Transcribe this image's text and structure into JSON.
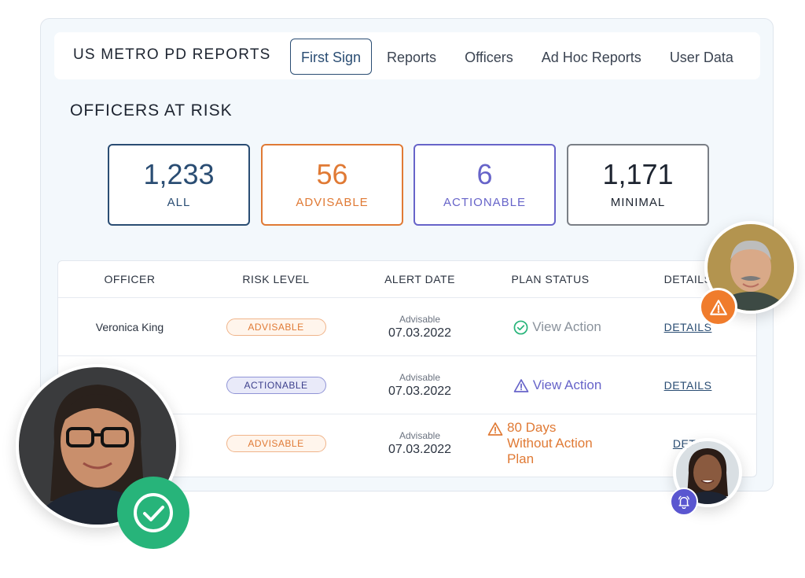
{
  "header": {
    "app_title": "US METRO PD REPORTS",
    "nav": [
      "First Sign",
      "Reports",
      "Officers",
      "Ad Hoc Reports",
      "User Data"
    ]
  },
  "section_title": "OFFICERS AT RISK",
  "stats": [
    {
      "value": "1,233",
      "label": "ALL",
      "color": "#2a4d73"
    },
    {
      "value": "56",
      "label": "ADVISABLE",
      "color": "#e07a35"
    },
    {
      "value": "6",
      "label": "ACTIONABLE",
      "color": "#6764c9"
    },
    {
      "value": "1,171",
      "label": "MINIMAL",
      "color": "#1d2430"
    }
  ],
  "table": {
    "headers": [
      "OFFICER",
      "RISK LEVEL",
      "ALERT DATE",
      "PLAN STATUS",
      "DETAILS"
    ],
    "rows": [
      {
        "officer": "Veronica King",
        "risk": "ADVISABLE",
        "alert_type": "Advisable",
        "alert_date": "07.03.2022",
        "plan": "View Action",
        "plan_icon": "check-circle-icon",
        "details": "DETAILS"
      },
      {
        "officer": "",
        "risk": "ACTIONABLE",
        "alert_type": "Advisable",
        "alert_date": "07.03.2022",
        "plan": "View Action",
        "plan_icon": "warning-triangle-icon",
        "details": "DETAILS"
      },
      {
        "officer": "",
        "risk": "ADVISABLE",
        "alert_type": "Advisable",
        "alert_date": "07.03.2022",
        "plan_lines": [
          "80 Days",
          "Without Action",
          "Plan"
        ],
        "plan_icon": "warning-triangle-icon",
        "details": "DETA"
      }
    ]
  },
  "colors": {
    "accent_navy": "#2a4d73",
    "advisable_orange": "#e07a35",
    "actionable_purple": "#6764c9",
    "success_green": "#27b47a"
  }
}
